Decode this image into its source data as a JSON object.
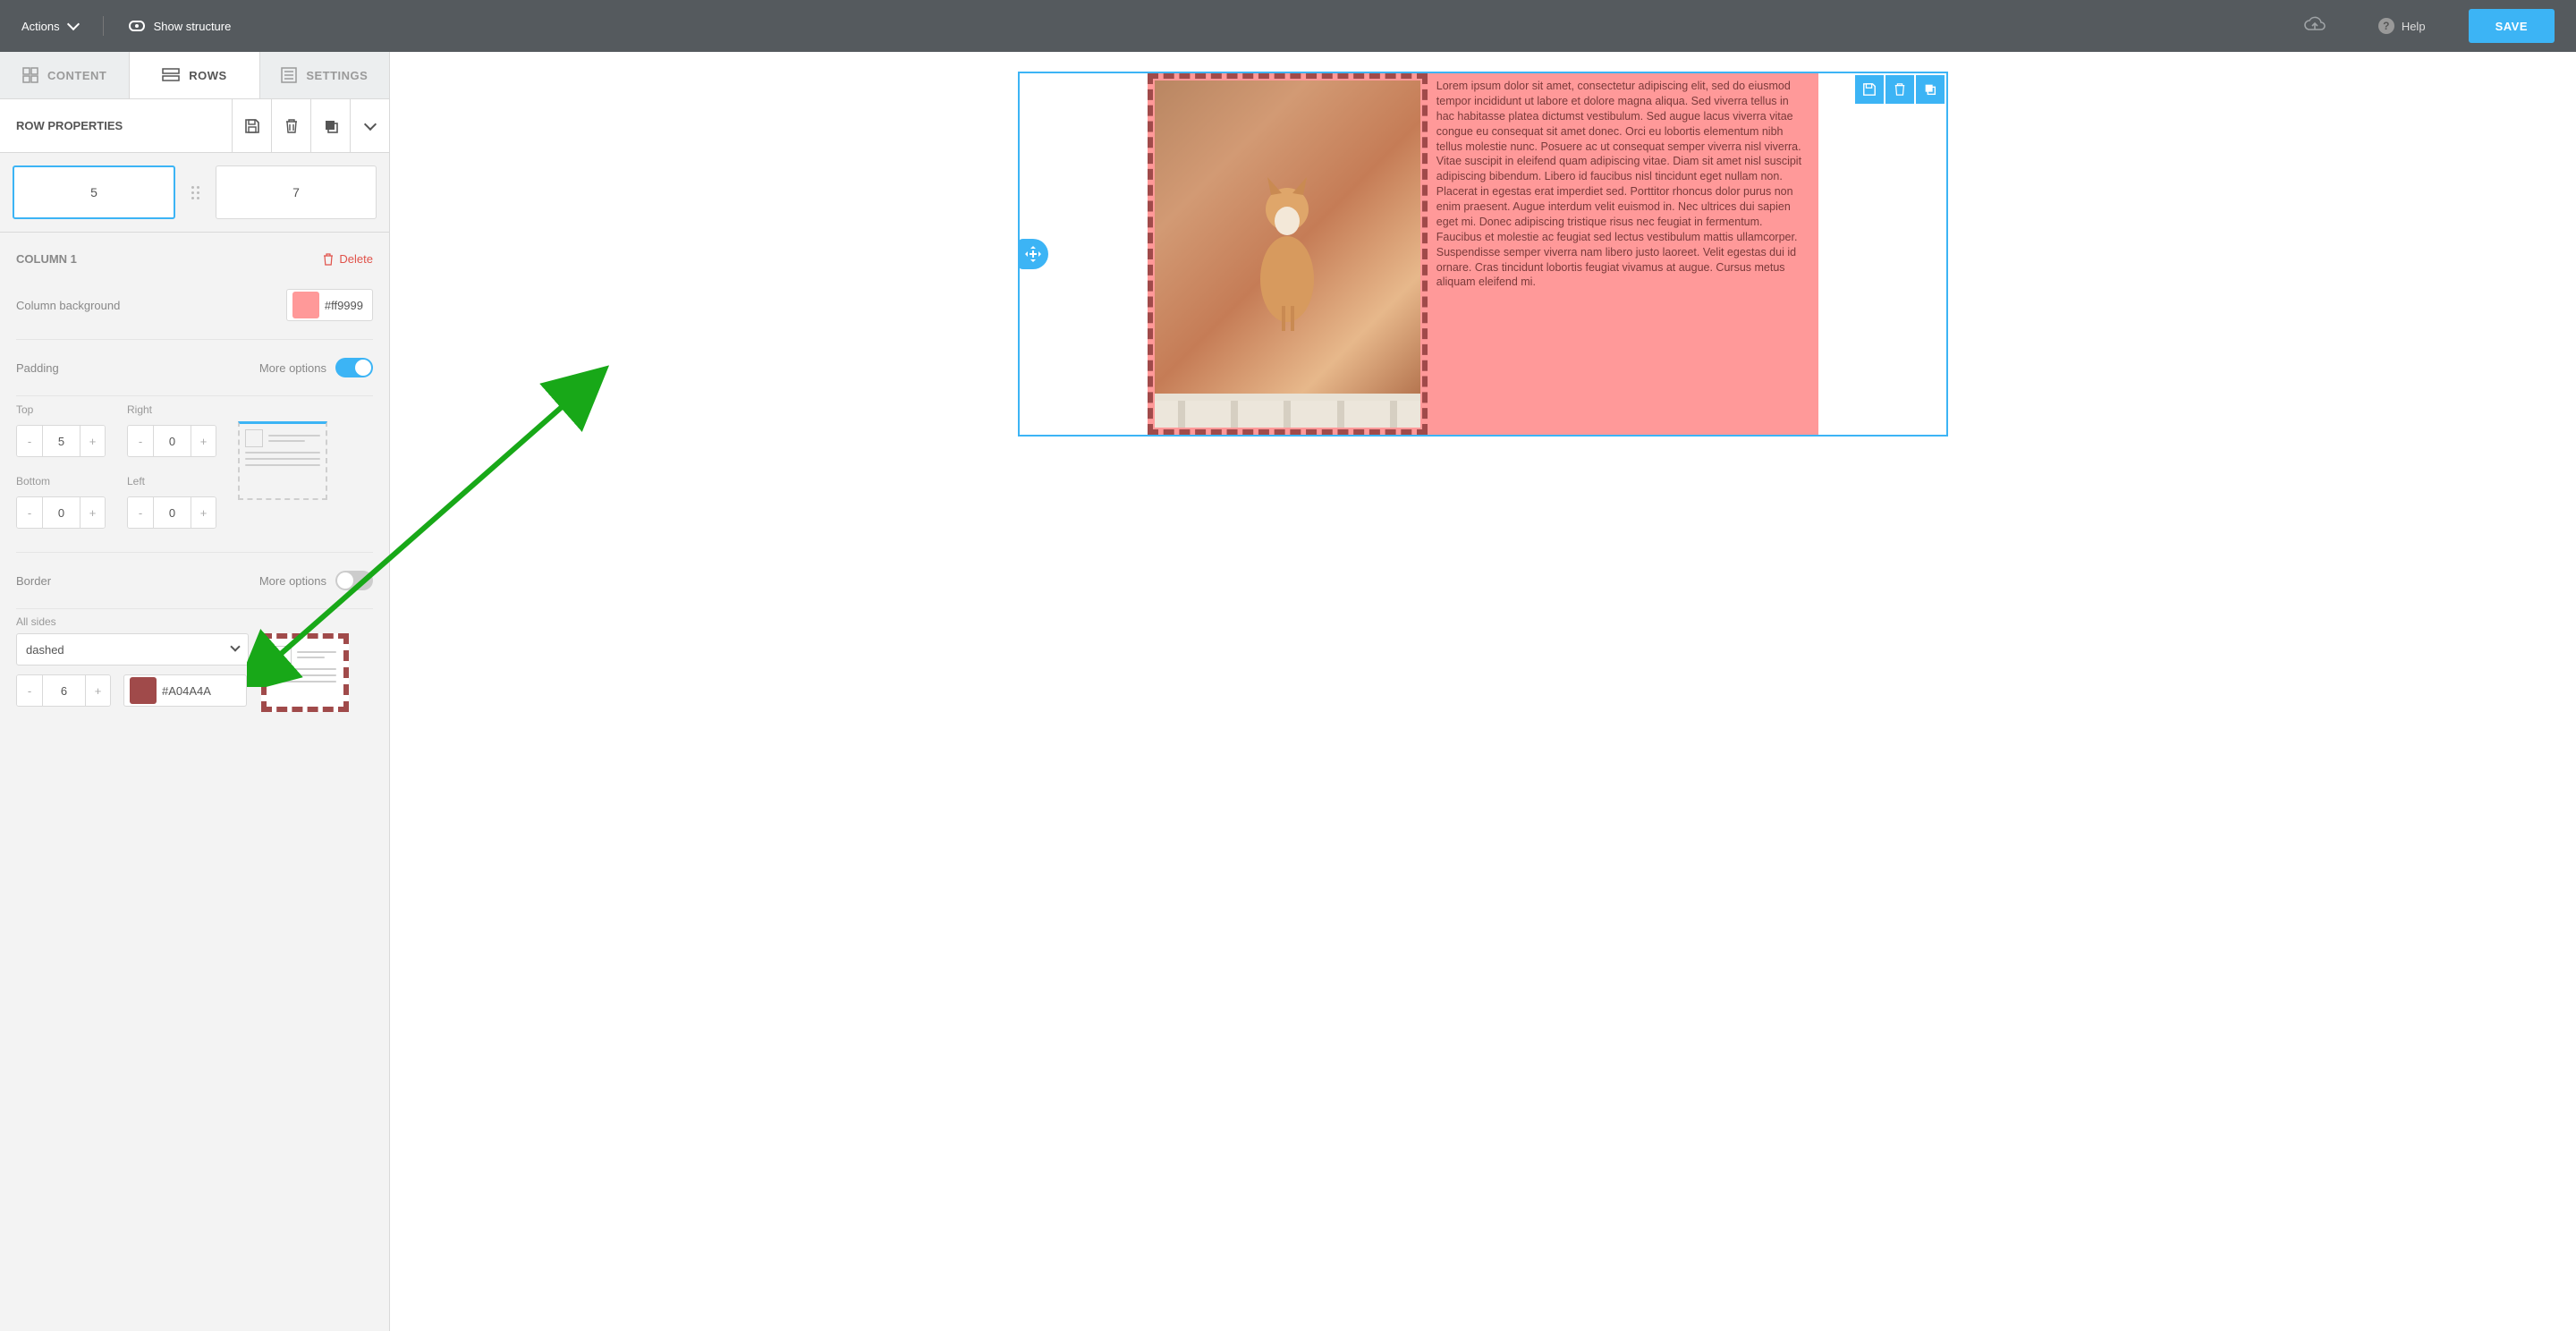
{
  "topbar": {
    "actions": "Actions",
    "show_structure": "Show structure",
    "help": "Help",
    "save": "SAVE"
  },
  "tabs": {
    "content": "CONTENT",
    "rows": "ROWS",
    "settings": "SETTINGS"
  },
  "section": {
    "title": "ROW PROPERTIES",
    "col1": "5",
    "col2": "7"
  },
  "props": {
    "column_heading": "COLUMN 1",
    "delete": "Delete",
    "bg_label": "Column background",
    "bg_value": "#ff9999",
    "padding_label": "Padding",
    "more_options": "More options",
    "top": "Top",
    "right": "Right",
    "bottom": "Bottom",
    "left": "Left",
    "top_v": "5",
    "right_v": "0",
    "bottom_v": "0",
    "left_v": "0",
    "border_label": "Border",
    "all_sides": "All sides",
    "border_style": "dashed",
    "border_width": "6",
    "border_color": "#A04A4A"
  },
  "canvas": {
    "lorem": "Lorem ipsum dolor sit amet, consectetur adipiscing elit, sed do eiusmod tempor incididunt ut labore et dolore magna aliqua. Sed viverra tellus in hac habitasse platea dictumst vestibulum. Sed augue lacus viverra vitae congue eu consequat sit amet donec. Orci eu lobortis elementum nibh tellus molestie nunc. Posuere ac ut consequat semper viverra nisl viverra. Vitae suscipit in eleifend quam adipiscing vitae. Diam sit amet nisl suscipit adipiscing bibendum. Libero id faucibus nisl tincidunt eget nullam non. Placerat in egestas erat imperdiet sed. Porttitor rhoncus dolor purus non enim praesent. Augue interdum velit euismod in. Nec ultrices dui sapien eget mi. Donec adipiscing tristique risus nec feugiat in fermentum. Faucibus et molestie ac feugiat sed lectus vestibulum mattis ullamcorper. Suspendisse semper viverra nam libero justo laoreet. Velit egestas dui id ornare. Cras tincidunt lobortis feugiat vivamus at augue. Cursus metus aliquam eleifend mi."
  }
}
